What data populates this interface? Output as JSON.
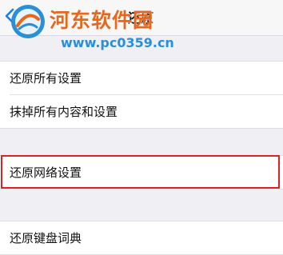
{
  "nav": {
    "back_label": "设置",
    "title": "还原"
  },
  "watermark": {
    "name": "河东软件园",
    "url": "www.pc0359.cn"
  },
  "groups": [
    {
      "items": [
        {
          "label": "还原所有设置"
        },
        {
          "label": "抹掉所有内容和设置"
        }
      ]
    },
    {
      "items": [
        {
          "label": "还原网络设置"
        }
      ]
    },
    {
      "items": [
        {
          "label": "还原键盘词典"
        }
      ]
    }
  ],
  "colors": {
    "accent": "#1a7cf5",
    "highlight_border": "#d9232a",
    "background": "#efeff4"
  }
}
